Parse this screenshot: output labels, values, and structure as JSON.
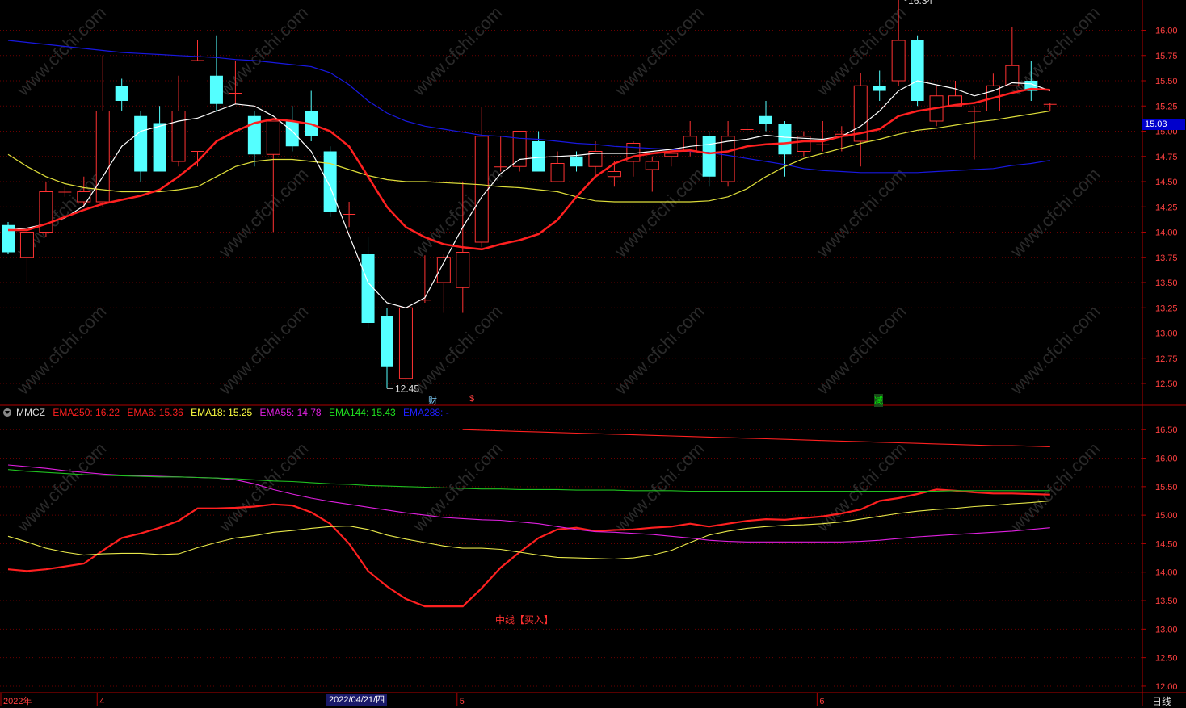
{
  "colors": {
    "up": "#ff3232",
    "down": "#54ffff",
    "grid": "#6a0000",
    "axis": "#b00000",
    "ma_white": "#ffffff",
    "ma_red": "#ff2020",
    "ma_yellow": "#dede3a",
    "ma_blue": "#1818e0",
    "ema250": "#ff2020",
    "ema6": "#ff2020",
    "ema18": "#e8e84a",
    "ema55": "#e020e0",
    "ema144": "#20c020",
    "ema288": "#2020ff"
  },
  "chart_data": [
    {
      "type": "candlestick",
      "ylim": [
        12.3,
        16.3
      ],
      "ticks": [
        "16.00",
        "15.75",
        "15.50",
        "15.25",
        "15.00",
        "14.75",
        "14.50",
        "14.25",
        "14.00",
        "13.75",
        "13.50",
        "13.25",
        "13.00",
        "12.75",
        "12.50"
      ],
      "candles": [
        [
          14.07,
          13.8,
          14.1,
          13.78
        ],
        [
          13.75,
          14.0,
          14.07,
          13.5
        ],
        [
          14.0,
          14.4,
          14.5,
          13.95
        ],
        [
          14.4,
          14.4,
          14.45,
          14.35
        ],
        [
          14.3,
          14.4,
          14.55,
          14.25
        ],
        [
          14.3,
          15.2,
          15.75,
          14.25
        ],
        [
          15.45,
          15.3,
          15.52,
          15.2
        ],
        [
          15.15,
          14.6,
          15.2,
          14.5
        ],
        [
          15.08,
          14.6,
          15.25,
          14.6
        ],
        [
          14.7,
          15.2,
          15.55,
          14.65
        ],
        [
          14.8,
          15.7,
          15.9,
          14.65
        ],
        [
          15.55,
          15.27,
          15.95,
          15.2
        ],
        [
          15.38,
          15.38,
          15.7,
          15.27
        ],
        [
          15.15,
          14.77,
          15.2,
          14.65
        ],
        [
          14.77,
          15.1,
          15.1,
          14.0
        ],
        [
          15.1,
          14.85,
          15.25,
          14.8
        ],
        [
          15.2,
          14.95,
          15.4,
          14.9
        ],
        [
          14.8,
          14.2,
          14.85,
          14.15
        ],
        [
          14.18,
          14.18,
          14.3,
          14.05
        ],
        [
          13.78,
          13.1,
          13.95,
          13.05
        ],
        [
          13.17,
          12.67,
          13.25,
          12.45
        ],
        [
          12.55,
          13.25,
          13.25,
          12.5
        ],
        [
          13.33,
          13.33,
          13.77,
          13.3
        ],
        [
          13.5,
          13.75,
          13.78,
          13.2
        ],
        [
          13.45,
          13.8,
          14.5,
          13.2
        ],
        [
          13.9,
          14.95,
          15.24,
          13.85
        ],
        [
          14.65,
          14.65,
          14.95,
          14.6
        ],
        [
          14.65,
          15.0,
          15.0,
          14.6
        ],
        [
          14.9,
          14.6,
          15.0,
          14.6
        ],
        [
          14.5,
          14.68,
          14.8,
          14.5
        ],
        [
          14.75,
          14.65,
          14.8,
          14.6
        ],
        [
          14.65,
          14.8,
          14.9,
          14.55
        ],
        [
          14.55,
          14.6,
          14.7,
          14.45
        ],
        [
          14.7,
          14.88,
          14.9,
          14.55
        ],
        [
          14.62,
          14.7,
          14.75,
          14.4
        ],
        [
          14.75,
          14.78,
          14.8,
          14.65
        ],
        [
          14.8,
          14.95,
          15.1,
          14.75
        ],
        [
          14.95,
          14.55,
          15.0,
          14.45
        ],
        [
          14.5,
          14.95,
          15.1,
          14.45
        ],
        [
          15.02,
          15.02,
          15.1,
          14.95
        ],
        [
          15.15,
          15.07,
          15.3,
          15.0
        ],
        [
          15.07,
          14.77,
          15.1,
          14.55
        ],
        [
          14.8,
          14.95,
          15.0,
          14.75
        ],
        [
          14.87,
          14.87,
          15.1,
          14.8
        ],
        [
          14.95,
          14.97,
          15.05,
          14.8
        ],
        [
          14.9,
          15.45,
          15.58,
          14.65
        ],
        [
          15.45,
          15.4,
          15.6,
          15.3
        ],
        [
          15.5,
          15.9,
          16.34,
          15.45
        ],
        [
          15.9,
          15.3,
          15.95,
          15.25
        ],
        [
          15.1,
          15.35,
          15.45,
          15.05
        ],
        [
          15.25,
          15.35,
          15.5,
          15.25
        ],
        [
          15.2,
          15.2,
          15.25,
          14.72
        ],
        [
          15.2,
          15.45,
          15.57,
          15.2
        ],
        [
          15.45,
          15.65,
          16.03,
          15.45
        ],
        [
          15.5,
          15.4,
          15.7,
          15.3
        ],
        [
          15.27,
          15.27,
          15.28,
          15.2
        ]
      ],
      "ma_white": [
        14.02,
        14.04,
        14.08,
        14.14,
        14.26,
        14.55,
        14.85,
        15.0,
        15.05,
        15.1,
        15.13,
        15.2,
        15.27,
        15.25,
        15.15,
        15.0,
        14.8,
        14.45,
        13.97,
        13.5,
        13.3,
        13.25,
        13.35,
        13.7,
        14.05,
        14.35,
        14.58,
        14.72,
        14.74,
        14.75,
        14.76,
        14.78,
        14.78,
        14.78,
        14.8,
        14.82,
        14.85,
        14.87,
        14.9,
        14.92,
        14.96,
        14.94,
        14.93,
        14.92,
        14.95,
        15.05,
        15.2,
        15.4,
        15.5,
        15.46,
        15.42,
        15.35,
        15.4,
        15.48,
        15.47,
        15.4
      ],
      "ma_red": [
        14.02,
        14.02,
        14.08,
        14.15,
        14.22,
        14.28,
        14.32,
        14.36,
        14.42,
        14.55,
        14.7,
        14.9,
        15.0,
        15.08,
        15.12,
        15.1,
        15.07,
        15.0,
        14.85,
        14.55,
        14.25,
        14.05,
        13.95,
        13.88,
        13.85,
        13.83,
        13.88,
        13.92,
        13.98,
        14.12,
        14.35,
        14.55,
        14.68,
        14.75,
        14.78,
        14.8,
        14.81,
        14.78,
        14.8,
        14.85,
        14.87,
        14.88,
        14.9,
        14.9,
        14.95,
        14.98,
        15.02,
        15.15,
        15.2,
        15.23,
        15.26,
        15.28,
        15.33,
        15.38,
        15.42,
        15.41
      ],
      "ma_yellow": [
        14.77,
        14.65,
        14.55,
        14.48,
        14.44,
        14.42,
        14.4,
        14.4,
        14.4,
        14.42,
        14.45,
        14.55,
        14.65,
        14.7,
        14.72,
        14.72,
        14.7,
        14.68,
        14.62,
        14.56,
        14.52,
        14.5,
        14.5,
        14.49,
        14.48,
        14.47,
        14.45,
        14.44,
        14.42,
        14.4,
        14.35,
        14.31,
        14.3,
        14.3,
        14.3,
        14.3,
        14.3,
        14.31,
        14.35,
        14.43,
        14.55,
        14.65,
        14.73,
        14.78,
        14.83,
        14.88,
        14.92,
        14.97,
        15.01,
        15.03,
        15.06,
        15.09,
        15.11,
        15.14,
        15.17,
        15.2
      ],
      "ma_blue": [
        15.9,
        15.88,
        15.86,
        15.84,
        15.82,
        15.8,
        15.78,
        15.77,
        15.76,
        15.75,
        15.74,
        15.73,
        15.71,
        15.7,
        15.68,
        15.66,
        15.64,
        15.58,
        15.46,
        15.3,
        15.18,
        15.1,
        15.05,
        15.02,
        14.99,
        14.96,
        14.95,
        14.93,
        14.92,
        14.9,
        14.88,
        14.87,
        14.85,
        14.84,
        14.83,
        14.82,
        14.8,
        14.79,
        14.76,
        14.73,
        14.7,
        14.67,
        14.63,
        14.61,
        14.6,
        14.59,
        14.59,
        14.59,
        14.59,
        14.6,
        14.61,
        14.62,
        14.63,
        14.66,
        14.68,
        14.71
      ],
      "annotations": {
        "high": "16.34",
        "low": "12.45",
        "last_price": "15.03"
      },
      "event_markers": [
        "财",
        "$",
        "减"
      ]
    },
    {
      "type": "line",
      "ylim": [
        11.9,
        16.9
      ],
      "ticks": [
        "16.50",
        "16.00",
        "15.50",
        "15.00",
        "14.50",
        "14.00",
        "13.50",
        "13.00",
        "12.50",
        "12.00"
      ],
      "series": [
        {
          "name": "EMA250",
          "start": 24,
          "values": [
            16.5,
            16.49,
            16.48,
            16.47,
            16.46,
            16.45,
            16.44,
            16.43,
            16.42,
            16.41,
            16.4,
            16.39,
            16.38,
            16.37,
            16.36,
            16.35,
            16.34,
            16.33,
            16.32,
            16.31,
            16.3,
            16.29,
            16.28,
            16.27,
            16.26,
            16.25,
            16.24,
            16.23,
            16.22,
            16.22,
            16.21,
            16.2
          ]
        },
        {
          "name": "EMA6",
          "start": 0,
          "values": [
            14.05,
            14.02,
            14.05,
            14.1,
            14.15,
            14.38,
            14.6,
            14.68,
            14.78,
            14.9,
            15.12,
            15.12,
            15.13,
            15.15,
            15.19,
            15.17,
            15.05,
            14.85,
            14.5,
            14.02,
            13.75,
            13.53,
            13.4,
            13.4,
            13.4,
            13.72,
            14.08,
            14.35,
            14.6,
            14.75,
            14.78,
            14.72,
            14.74,
            14.75,
            14.78,
            14.8,
            14.85,
            14.8,
            14.85,
            14.9,
            14.93,
            14.92,
            14.95,
            14.98,
            15.03,
            15.1,
            15.25,
            15.3,
            15.37,
            15.45,
            15.43,
            15.4,
            15.38,
            15.38,
            15.37,
            15.36
          ]
        },
        {
          "name": "EMA18",
          "start": 0,
          "values": [
            14.63,
            14.53,
            14.42,
            14.35,
            14.3,
            14.32,
            14.33,
            14.33,
            14.31,
            14.32,
            14.43,
            14.52,
            14.6,
            14.64,
            14.7,
            14.73,
            14.77,
            14.8,
            14.81,
            14.75,
            14.65,
            14.58,
            14.52,
            14.46,
            14.42,
            14.42,
            14.4,
            14.35,
            14.3,
            14.26,
            14.25,
            14.24,
            14.23,
            14.25,
            14.3,
            14.38,
            14.52,
            14.65,
            14.72,
            14.77,
            14.8,
            14.82,
            14.83,
            14.85,
            14.88,
            14.93,
            14.98,
            15.03,
            15.07,
            15.1,
            15.12,
            15.15,
            15.17,
            15.2,
            15.22,
            15.25
          ]
        },
        {
          "name": "EMA55",
          "start": 0,
          "values": [
            15.88,
            15.85,
            15.82,
            15.78,
            15.75,
            15.72,
            15.7,
            15.69,
            15.68,
            15.67,
            15.66,
            15.65,
            15.62,
            15.55,
            15.45,
            15.37,
            15.3,
            15.24,
            15.19,
            15.14,
            15.09,
            15.04,
            15.0,
            14.96,
            14.94,
            14.92,
            14.91,
            14.88,
            14.85,
            14.8,
            14.75,
            14.71,
            14.7,
            14.68,
            14.66,
            14.63,
            14.6,
            14.56,
            14.54,
            14.53,
            14.53,
            14.53,
            14.53,
            14.53,
            14.53,
            14.54,
            14.56,
            14.59,
            14.62,
            14.64,
            14.66,
            14.68,
            14.7,
            14.72,
            14.75,
            14.78
          ]
        },
        {
          "name": "EMA144",
          "start": 0,
          "values": [
            15.8,
            15.77,
            15.75,
            15.73,
            15.71,
            15.7,
            15.69,
            15.68,
            15.67,
            15.67,
            15.66,
            15.65,
            15.64,
            15.62,
            15.6,
            15.59,
            15.57,
            15.55,
            15.54,
            15.52,
            15.51,
            15.5,
            15.49,
            15.48,
            15.47,
            15.46,
            15.46,
            15.45,
            15.45,
            15.45,
            15.44,
            15.44,
            15.44,
            15.43,
            15.43,
            15.43,
            15.42,
            15.42,
            15.42,
            15.42,
            15.42,
            15.42,
            15.42,
            15.42,
            15.42,
            15.42,
            15.42,
            15.42,
            15.42,
            15.42,
            15.43,
            15.43,
            15.43,
            15.43,
            15.43,
            15.43
          ]
        },
        {
          "name": "EMA288",
          "start": 0,
          "values": []
        }
      ],
      "annotations": [
        "中线【买入】"
      ]
    }
  ],
  "indicator_legend": {
    "name": "MMCZ",
    "items": [
      {
        "label": "EMA250: 16.22",
        "key": "ema250"
      },
      {
        "label": "EMA6: 15.36",
        "key": "ema6"
      },
      {
        "label": "EMA18: 15.25",
        "key": "ema18"
      },
      {
        "label": "EMA55: 14.78",
        "key": "ema55"
      },
      {
        "label": "EMA144: 15.43",
        "key": "ema144"
      },
      {
        "label": "EMA288: -",
        "key": "ema288"
      }
    ]
  },
  "x_axis": {
    "labels": [
      {
        "text": "2022年",
        "index": 0
      },
      {
        "text": "4",
        "index": 5
      },
      {
        "text": "5",
        "index": 24
      },
      {
        "text": "6",
        "index": 43
      }
    ],
    "cursor_date": "2022/04/21/四",
    "period": "日线"
  },
  "watermark": "www.cfchi.com"
}
